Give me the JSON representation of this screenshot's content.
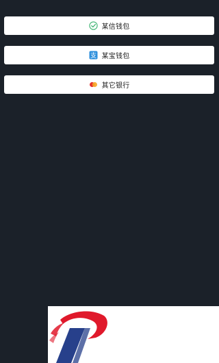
{
  "payment_options": [
    {
      "label": "某信钱包",
      "icon": "wechat-check-icon",
      "color": "#3cb371"
    },
    {
      "label": "某宝钱包",
      "icon": "alipay-icon",
      "color": "#2d8fdc"
    },
    {
      "label": "其它银行",
      "icon": "bank-card-icon",
      "colors": [
        "#e3342f",
        "#f6a623"
      ]
    }
  ],
  "logo": {
    "colors": [
      "#e0192b",
      "#27408b"
    ]
  }
}
